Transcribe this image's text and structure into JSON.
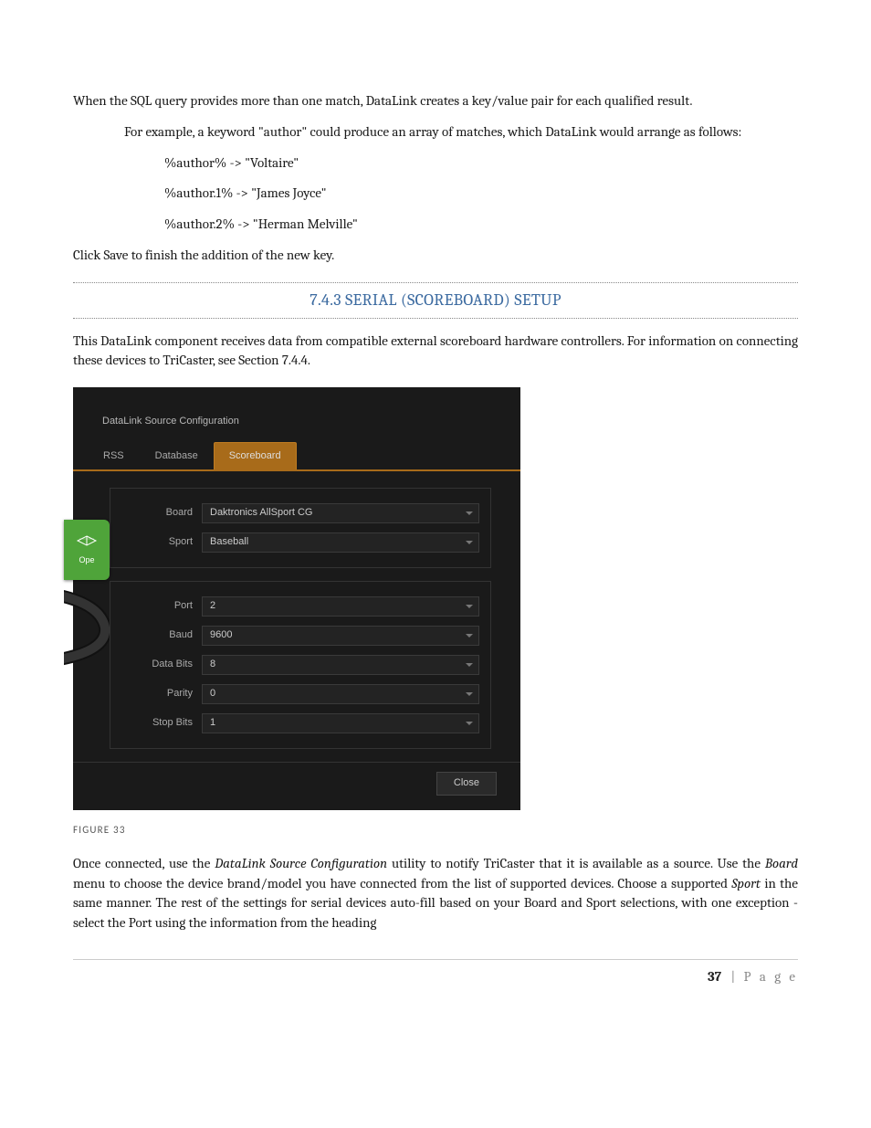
{
  "para_intro": "When the SQL query provides more than one match, DataLink creates a key/value pair for each qualified result.",
  "para_example_lead": "For example, a keyword \"author\" could produce an array of matches, which DataLink would arrange as follows:",
  "ex1": "%author% -> \"Voltaire\"",
  "ex2": "%author.1% -> \"James Joyce\"",
  "ex3": "%author.2% -> \"Herman Melville\"",
  "para_click_save": "Click Save to finish the addition of the new key.",
  "heading_number": "7.4.3",
  "heading_text": "SERIAL (SCOREBOARD) SETUP",
  "para_component": "This DataLink component receives data from compatible external scoreboard hardware controllers. For information on connecting these devices to TriCaster, see Section 7.4.4.",
  "dialog": {
    "title": "DataLink Source Configuration",
    "tabs": [
      "RSS",
      "Database",
      "Scoreboard"
    ],
    "active_tab": 2,
    "fields": {
      "Board": "Daktronics AllSport CG",
      "Sport": "Baseball",
      "Port": "2",
      "Baud": "9600",
      "Data Bits": "8",
      "Parity": "0",
      "Stop Bits": "1"
    },
    "close_label": "Close",
    "badge_label": "Ope"
  },
  "figure_caption": "FIGURE 33",
  "para_once_1": "Once connected, use the ",
  "para_once_em1": "DataLink Source Configuration",
  "para_once_2": " utility to notify TriCaster that it is available as a source. Use the ",
  "para_once_em2": "Board",
  "para_once_3": " menu to choose the device brand/model you have connected from the list of supported devices. Choose a supported ",
  "para_once_em3": "Sport",
  "para_once_4": " in the same manner.  The rest of the settings for serial devices auto-fill based on your Board and Sport selections, with one exception - select the Port using the information from the heading",
  "page_number": "37",
  "page_label": "P a g e"
}
